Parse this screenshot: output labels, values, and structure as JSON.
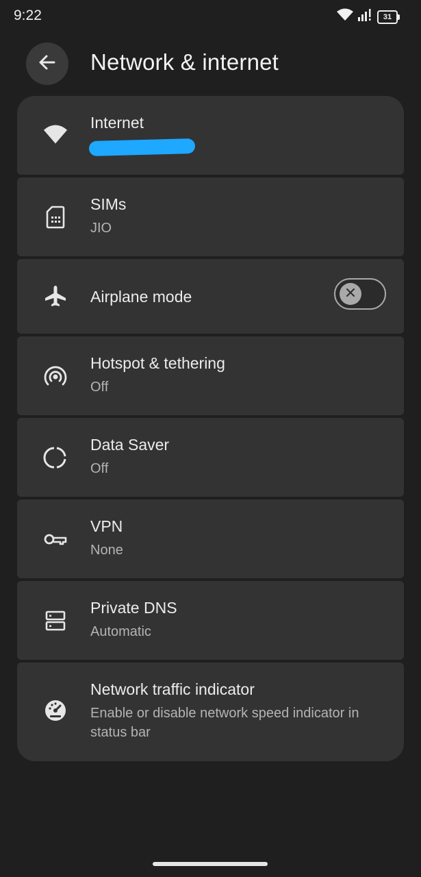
{
  "status_bar": {
    "time": "9:22",
    "battery": "31",
    "icons": [
      "wifi-icon",
      "signal-icon",
      "battery-icon"
    ]
  },
  "header": {
    "title": "Network & internet",
    "back_icon": "arrow-left-icon"
  },
  "items": [
    {
      "title": "Internet",
      "subtitle": "",
      "icon": "wifi-icon",
      "redacted": true
    },
    {
      "title": "SIMs",
      "subtitle": "JIO",
      "icon": "sim-card-icon"
    },
    {
      "title": "Airplane mode",
      "subtitle": "",
      "icon": "airplane-icon",
      "toggle": "off"
    },
    {
      "title": "Hotspot & tethering",
      "subtitle": "Off",
      "icon": "hotspot-icon"
    },
    {
      "title": "Data Saver",
      "subtitle": "Off",
      "icon": "data-saver-icon"
    },
    {
      "title": "VPN",
      "subtitle": "None",
      "icon": "vpn-key-icon"
    },
    {
      "title": "Private DNS",
      "subtitle": "Automatic",
      "icon": "dns-icon"
    },
    {
      "title": "Network traffic indicator",
      "subtitle": "Enable or disable network speed indicator in status bar",
      "icon": "speedometer-icon"
    }
  ],
  "colors": {
    "background": "#1f1f1f",
    "card": "#333333",
    "redaction": "#1ea8ff"
  }
}
